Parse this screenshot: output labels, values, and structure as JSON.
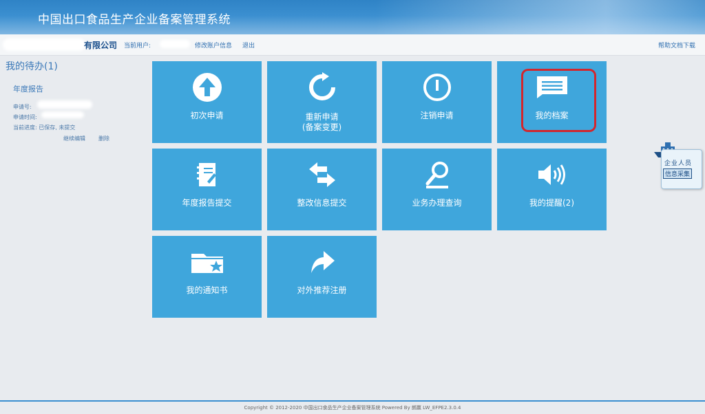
{
  "header": {
    "title": "中国出口食品生产企业备案管理系统"
  },
  "userbar": {
    "company_suffix": "有限公司",
    "current_user_label": "当前用户:",
    "edit_account": "修改账户信息",
    "logout": "退出",
    "help_download": "帮助文档下载"
  },
  "todo": {
    "title": "我的待办(1)",
    "item_title": "年度报告",
    "apply_no_label": "申请号:",
    "apply_time_label": "申请时间:",
    "progress_label": "当前进度: 已保存, 未提交",
    "continue_edit": "继续编辑",
    "delete": "删除"
  },
  "tiles": [
    {
      "label": "初次申请",
      "icon": "arrow-up-circle-icon"
    },
    {
      "label": "重新申请",
      "label2": "(备案变更)",
      "icon": "refresh-icon"
    },
    {
      "label": "注销申请",
      "icon": "power-circle-icon"
    },
    {
      "label": "我的档案",
      "icon": "message-list-icon"
    },
    {
      "label": "年度报告提交",
      "icon": "notebook-icon"
    },
    {
      "label": "整改信息提交",
      "icon": "swap-arrows-icon"
    },
    {
      "label": "业务办理查询",
      "icon": "magnifier-icon"
    },
    {
      "label": "我的提醒(2)",
      "icon": "speaker-icon"
    },
    {
      "label": "我的通知书",
      "icon": "folder-star-icon"
    },
    {
      "label": "对外推荐注册",
      "icon": "share-arrow-icon"
    }
  ],
  "widget": {
    "line1": "企业人员",
    "line2": "信息采集"
  },
  "footer": {
    "copyright": "Copyright © 2012-2020 中国出口食品生产企业备案管理系统 Powered By 朗赢 LW_EFPE2.3.0.4"
  },
  "colors": {
    "tile": "#3fa6dc",
    "highlight": "#d3262d",
    "header": "#3b8fd0"
  }
}
